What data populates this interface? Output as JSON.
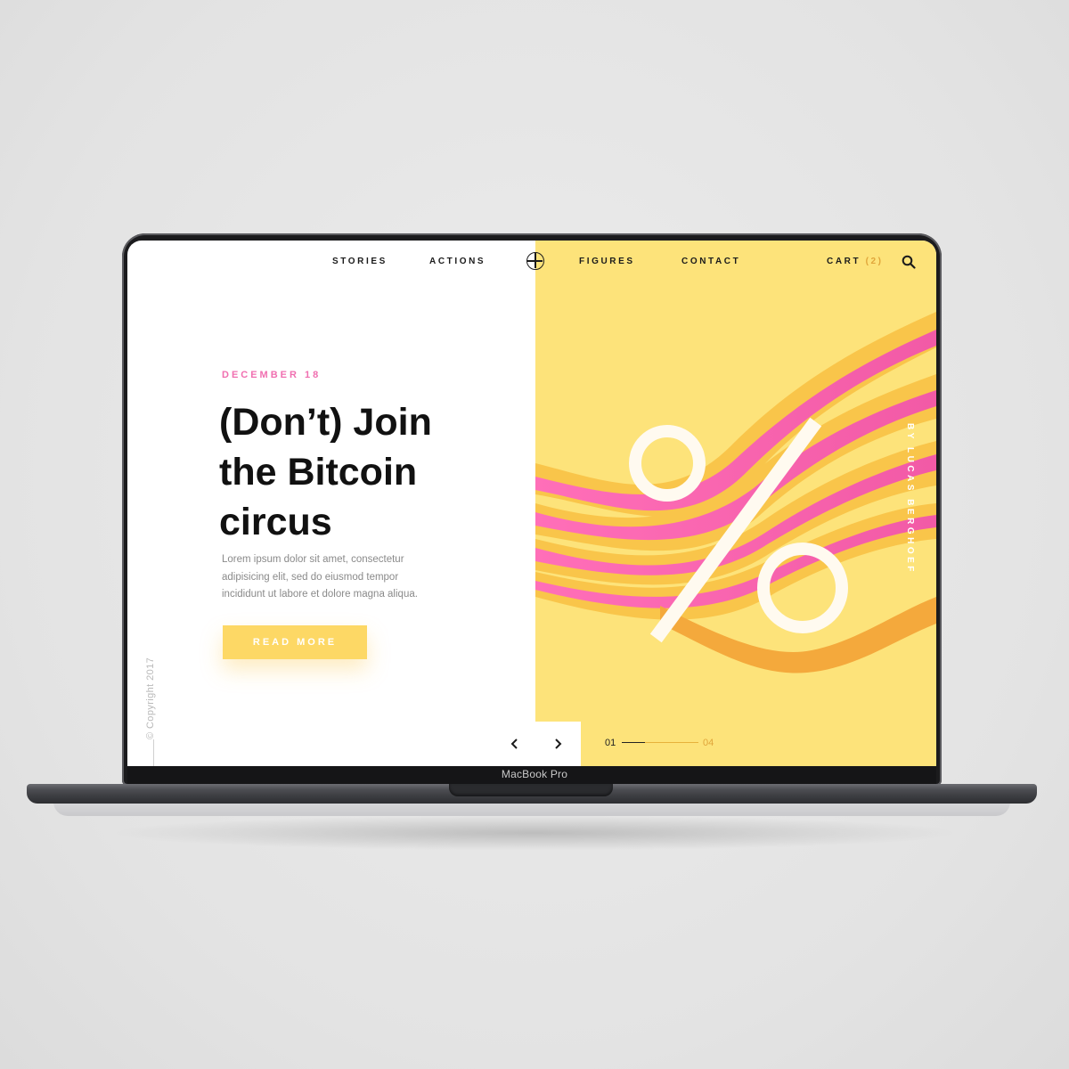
{
  "nav": {
    "items": [
      "STORIES",
      "ACTIONS",
      "FIGURES",
      "CONTACT"
    ],
    "cart_label": "CART",
    "cart_count": "(2)"
  },
  "hero": {
    "date": "DECEMBER 18",
    "headline_lines": [
      "(Don’t) Join",
      "the Bitcoin",
      "circus"
    ],
    "body_lines": [
      "Lorem ipsum dolor sit amet, consectetur",
      "adipisicing elit, sed do eiusmod tempor",
      "incididunt ut labore et dolore magna aliqua."
    ],
    "cta_label": "READ MORE"
  },
  "side": {
    "copyright": "© Copyright 2017",
    "byline": "BY LUCAS BERGHOEF"
  },
  "pager": {
    "current": "01",
    "total": "04"
  },
  "device": {
    "label": "MacBook Pro"
  },
  "colors": {
    "accent_yellow": "#fde37a",
    "button_yellow": "#fdd865",
    "accent_pink": "#f06fb0",
    "pager_orange": "#e0a53a"
  }
}
